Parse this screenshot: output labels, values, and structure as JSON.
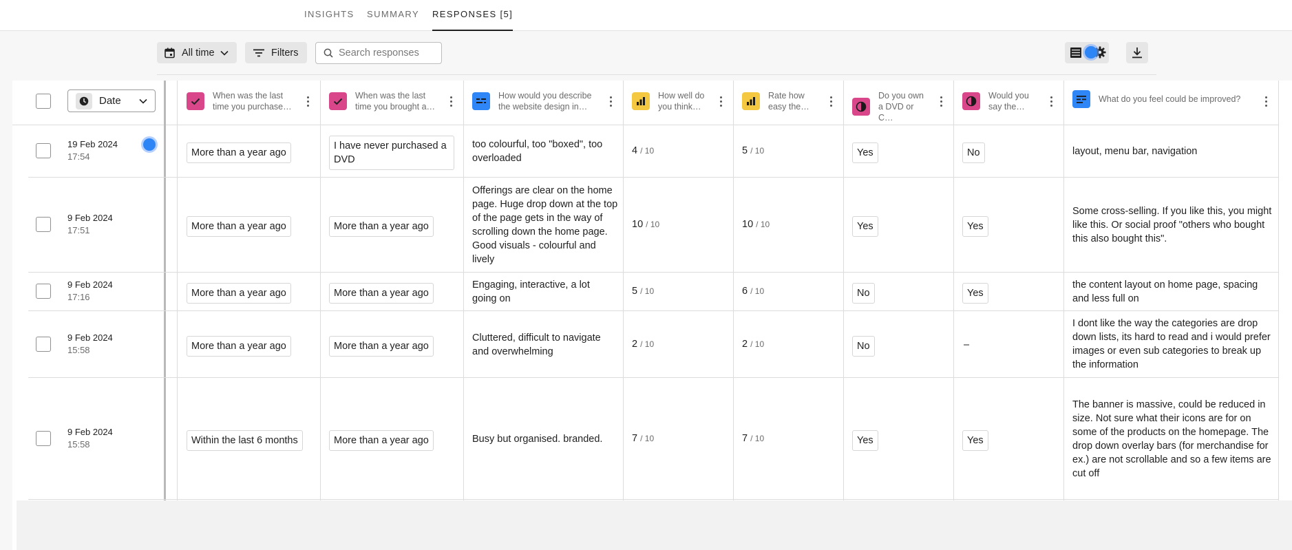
{
  "tabs": {
    "insights": "INSIGHTS",
    "summary": "SUMMARY",
    "responses": "RESPONSES [5]"
  },
  "toolbar": {
    "time_filter": "All time",
    "filters": "Filters",
    "search_placeholder": "Search responses"
  },
  "table": {
    "date_column": "Date",
    "questions": [
      {
        "text": "When was the last time you purchase…",
        "type": "checkbox-icon",
        "color": "#d9468a"
      },
      {
        "text": "When was the last time you brought a…",
        "type": "checkbox-icon",
        "color": "#d9468a"
      },
      {
        "text": "How would you describe the website design in…",
        "type": "text-lines-icon",
        "color": "#2f86f6"
      },
      {
        "text": "How well do you think…",
        "type": "bar-chart-icon",
        "color": "#f5c842"
      },
      {
        "text": "Rate how easy the…",
        "type": "bar-chart-icon",
        "color": "#f5c842"
      },
      {
        "text": "Do you own a DVD or C…",
        "type": "yes-no-icon",
        "color": "#d9468a"
      },
      {
        "text": "Would you say the…",
        "type": "yes-no-icon",
        "color": "#d9468a"
      },
      {
        "text": "What do you feel could be improved?",
        "type": "paragraph-icon",
        "color": "#2f86f6"
      }
    ],
    "score_denominator": "/ 10",
    "rows": [
      {
        "date": "19 Feb 2024",
        "time": "17:54",
        "q1": "More than a year ago",
        "q2": "I have never purchased a DVD",
        "q3": "too colourful, too \"boxed\", too overloaded",
        "q4": "4",
        "q5": "5",
        "q6": "Yes",
        "q7": "No",
        "q8": "layout, menu bar, navigation"
      },
      {
        "date": "9 Feb 2024",
        "time": "17:51",
        "q1": "More than a year ago",
        "q2": "More than a year ago",
        "q3": "Offerings are clear on the home page. Huge drop down at the top of the page gets in the way of scrolling down the home page. Good visuals - colourful and lively",
        "q4": "10",
        "q5": "10",
        "q6": "Yes",
        "q7": "Yes",
        "q8": "Some cross-selling. If you like this, you might like this. Or social proof \"others who bought this also bought this\"."
      },
      {
        "date": "9 Feb 2024",
        "time": "17:16",
        "q1": "More than a year ago",
        "q2": "More than a year ago",
        "q3": "Engaging, interactive, a lot going on",
        "q4": "5",
        "q5": "6",
        "q6": "No",
        "q7": "Yes",
        "q8": "the content layout on home page, spacing and less full on"
      },
      {
        "date": "9 Feb 2024",
        "time": "15:58",
        "q1": "More than a year ago",
        "q2": "More than a year ago",
        "q3": "Cluttered, difficult to navigate and overwhelming",
        "q4": "2",
        "q5": "2",
        "q6": "No",
        "q7": "–",
        "q8": "I dont like the way the categories are drop down lists, its hard to read and i would prefer images or even sub categories to break up the information"
      },
      {
        "date": "9 Feb 2024",
        "time": "15:58",
        "q1": "Within the last 6 months",
        "q2": "More than a year ago",
        "q3": "Busy but organised. branded.",
        "q4": "7",
        "q5": "7",
        "q6": "Yes",
        "q7": "Yes",
        "q8": "The banner is massive, could be reduced in size. Not sure what their icons are for on some of the products on the homepage. The drop down overlay bars (for merchandise for ex.) are not scrollable and so a few items are cut off"
      }
    ]
  }
}
